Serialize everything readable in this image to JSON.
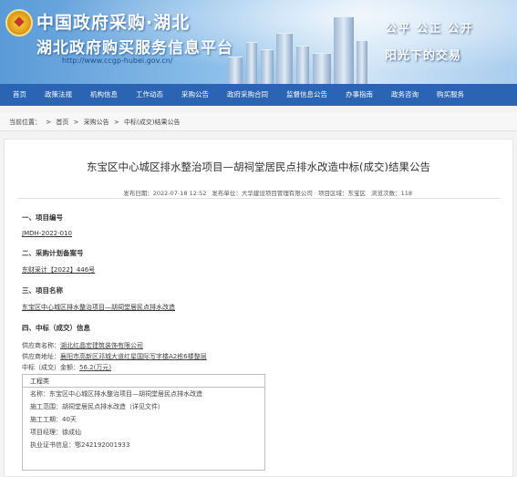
{
  "header": {
    "title_line1": "中国政府采购·湖北",
    "title_line2": "湖北政府购买服务信息平台",
    "url": "http://www.ccgp-hubei.gov.cn/",
    "slogan1": "公平  公正  公开",
    "slogan2": "阳光下的交易"
  },
  "nav": {
    "items": [
      "首页",
      "政策法规",
      "机构信息",
      "工作动态",
      "采购公告",
      "政府采购合同",
      "监督信息公告",
      "办事指南",
      "政务咨询",
      "购买服务"
    ]
  },
  "breadcrumb": {
    "prefix": "当前位置：",
    "items": [
      "首页",
      "采购公告",
      "中标(成交)结果公告"
    ],
    "separator": ">"
  },
  "article": {
    "title": "东宝区中心城区排水整治项目—胡祠堂居民点排水改造中标(成交)结果公告",
    "publish_time": "发布日期：2022-07-18 12:52",
    "publisher": "发布单位：大华建设项目管理有限公司",
    "region": "项目区域：东宝区",
    "views": "浏览次数：118",
    "s1_title": "一、项目编号",
    "s1_value": "JMDH-2022-010",
    "s2_title": "二、采购计划备案号",
    "s2_value": "东财采计【2022】446号",
    "s3_title": "三、项目名称",
    "s3_value": "东宝区中心城区排水整治项目—胡祠堂居民点排水改造",
    "s4_title": "四、中标（成交）信息",
    "supplier_name_label": "供应商名称：",
    "supplier_name": "湖北红晶宏建筑装饰有限公司",
    "supplier_addr_label": "供应商地址：",
    "supplier_addr": "襄阳市高新区邓城大道红星国际写字楼A2栋6楼整层",
    "amount_label": "中标（成交）金额：",
    "amount": "56.2(万元)"
  },
  "engineering": {
    "header": "工程类",
    "rows": [
      "名称：东宝区中心城区排水整治项目—胡祠堂居民点排水改造",
      "施工范围：胡祠堂居民点排水改造（详见文件）",
      "施工工期：40天",
      "项目经理：徐成仙",
      "执业证书信息：鄂242192001933"
    ]
  }
}
